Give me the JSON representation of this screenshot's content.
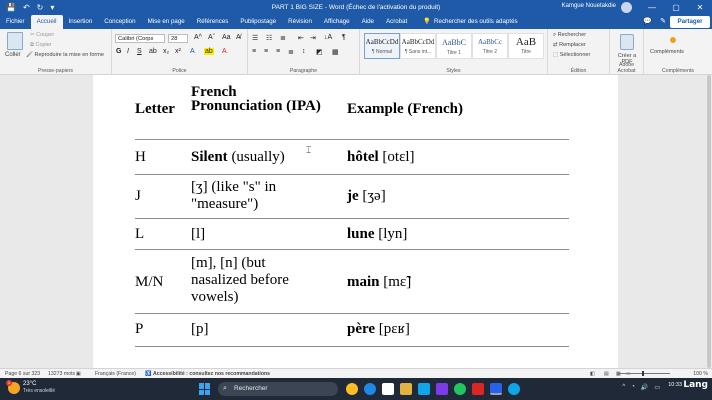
{
  "titlebar": {
    "doc_title": "PART 1 BIG SIZE  -  Word (Échec de l'activation du produit)",
    "user_name": "Kamgue Nouetakdie",
    "minimize": "—",
    "maximize": "▢",
    "close": "✕"
  },
  "tabs": [
    "Fichier",
    "Accueil",
    "Insertion",
    "Conception",
    "Mise en page",
    "Références",
    "Publipostage",
    "Révision",
    "Affichage",
    "Aide",
    "Acrobat"
  ],
  "tab_search": "Rechercher des outils adaptés",
  "share_label": "Partager",
  "ribbon": {
    "clipboard": {
      "paste": "Coller",
      "cut": "Couper",
      "copy": "Copier",
      "format_painter": "Reproduire la mise en forme",
      "label": "Presse-papiers"
    },
    "font": {
      "family": "Calibri (Corps",
      "size": "28",
      "bold": "G",
      "italic": "I",
      "underline": "S",
      "label": "Police"
    },
    "paragraph": {
      "label": "Paragraphe"
    },
    "styles": {
      "items": [
        {
          "sample": "AaBbCcDd",
          "name": "¶ Normal"
        },
        {
          "sample": "AaBbCcDd",
          "name": "¶ Sans int..."
        },
        {
          "sample": "AaBbC",
          "name": "Titre 1"
        },
        {
          "sample": "AaBbCc",
          "name": "Titre 2"
        },
        {
          "sample": "AaB",
          "name": "Titre"
        }
      ],
      "label": "Styles"
    },
    "editing": {
      "find": "Rechercher",
      "replace": "Remplacer",
      "select": "Sélectionner",
      "label": "Édition"
    },
    "acrobat": {
      "create_pdf": "Créer a PDF",
      "label": "Adobe Acrobat"
    },
    "addins": {
      "name": "Compléments",
      "label": "Compléments"
    }
  },
  "document": {
    "header": {
      "c1": "Letter",
      "c2": "French Pronunciation (IPA)",
      "c3": "Example (French)"
    },
    "rows": [
      {
        "letter": "H",
        "pron_bold": "Silent",
        "pron_rest": " (usually)",
        "ex_bold": "hôtel",
        "ex_rest": " [otɛl]"
      },
      {
        "letter": "J",
        "pron_bold": "",
        "pron_rest": "[ʒ] (like \"s\" in \"measure\")",
        "ex_bold": "je",
        "ex_rest": " [ʒə]"
      },
      {
        "letter": "L",
        "pron_bold": "",
        "pron_rest": "[l]",
        "ex_bold": "lune",
        "ex_rest": " [lyn]"
      },
      {
        "letter": "M/N",
        "pron_bold": "",
        "pron_rest": "[m], [n] (but nasalized before vowels)",
        "ex_bold": "main",
        "ex_rest": " [mɛ̃]"
      },
      {
        "letter": "P",
        "pron_bold": "",
        "pron_rest": "[p]",
        "ex_bold": "père",
        "ex_rest": " [pɛʁ]"
      }
    ]
  },
  "statusbar": {
    "page": "Page 6 sur 323",
    "words": "13273 mots",
    "language": "Français (France)",
    "accessibility": "Accessibilité : consultez nos recommandations",
    "zoom": "100 %"
  },
  "taskbar": {
    "temp": "23°C",
    "condition": "Très ensoleillé",
    "badge": "1",
    "search": "Rechercher",
    "time": "10:33",
    "brand": "Lang"
  },
  "colors": {
    "accent": "#1e5aa8",
    "taskbar": "#1f2937"
  }
}
